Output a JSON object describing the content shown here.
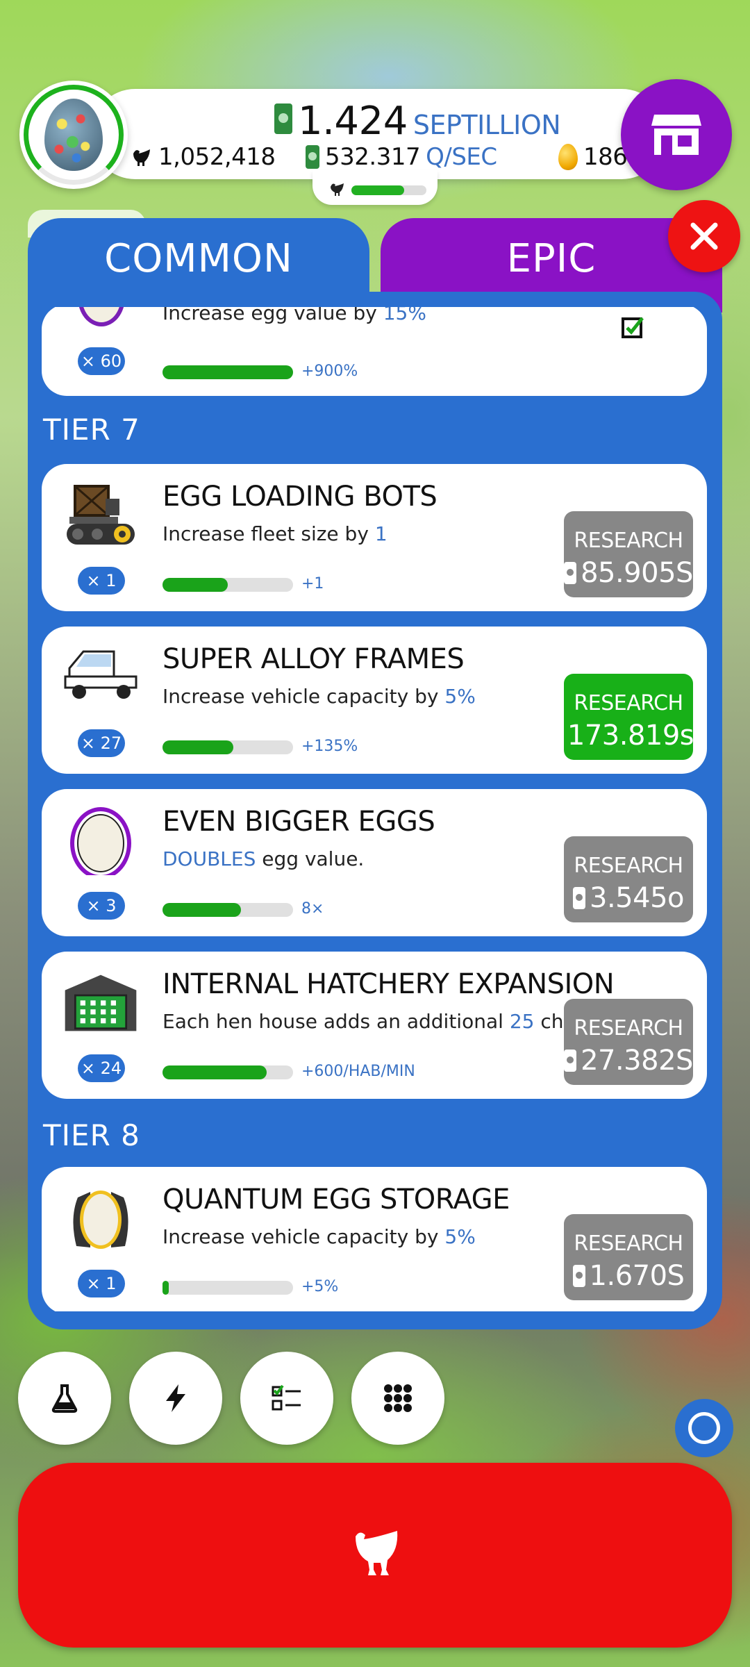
{
  "header": {
    "money_value": "1.424",
    "money_unit": "SEPTILLION",
    "chickens": "1,052,418",
    "rate_value": "532.317",
    "rate_unit": "Q/SEC",
    "golden_eggs": "186",
    "hatch_progress": 0.7
  },
  "tabs": {
    "common": "COMMON",
    "epic": "EPIC"
  },
  "partial_card": {
    "desc_prefix": "Increase egg value by ",
    "desc_highlight": "15%",
    "badge": "× 60",
    "progress": 1.0,
    "gain": "+900%"
  },
  "tier7": {
    "label": "TIER 7"
  },
  "tier8": {
    "label": "TIER 8"
  },
  "research_label": "RESEARCH",
  "cards": [
    {
      "title": "EGG LOADING BOTS",
      "desc_prefix": "Increase fleet size by ",
      "desc_highlight": "1",
      "desc_suffix": "",
      "badge": "× 1",
      "progress": 0.5,
      "gain": "+1",
      "cost": "85.905S",
      "affordable": false,
      "icon": "loader-bot-icon"
    },
    {
      "title": "SUPER ALLOY FRAMES",
      "desc_prefix": "Increase vehicle capacity by ",
      "desc_highlight": "5%",
      "desc_suffix": "",
      "badge": "× 27",
      "progress": 0.54,
      "gain": "+135%",
      "cost": "173.819s",
      "affordable": true,
      "icon": "truck-icon"
    },
    {
      "title": "EVEN BIGGER EGGS",
      "desc_prefix": "",
      "desc_highlight": "DOUBLES",
      "desc_suffix": " egg value.",
      "badge": "× 3",
      "progress": 0.6,
      "gain": "8×",
      "cost": "3.545o",
      "affordable": false,
      "icon": "egg-icon"
    },
    {
      "title": "INTERNAL HATCHERY EXPANSION",
      "desc_prefix": "Each hen house adds an additional ",
      "desc_highlight": "25",
      "desc_suffix": " chickens/min",
      "badge": "× 24",
      "progress": 0.8,
      "gain": "+600/HAB/MIN",
      "cost": "27.382S",
      "affordable": false,
      "icon": "hatchery-icon"
    },
    {
      "title": "QUANTUM EGG STORAGE",
      "desc_prefix": "Increase vehicle capacity by ",
      "desc_highlight": "5%",
      "desc_suffix": "",
      "badge": "× 1",
      "progress": 0.05,
      "gain": "+5%",
      "cost": "1.670S",
      "affordable": false,
      "icon": "quantum-egg-icon"
    }
  ],
  "colors": {
    "panel_blue": "#2a6fd0",
    "epic_purple": "#8a12c5",
    "research_green": "#18b018",
    "research_gray": "#878787",
    "hatch_red": "#ee0f10"
  },
  "toolbar_icons": [
    "flask-icon",
    "bolt-icon",
    "checklist-icon",
    "grid-icon"
  ]
}
